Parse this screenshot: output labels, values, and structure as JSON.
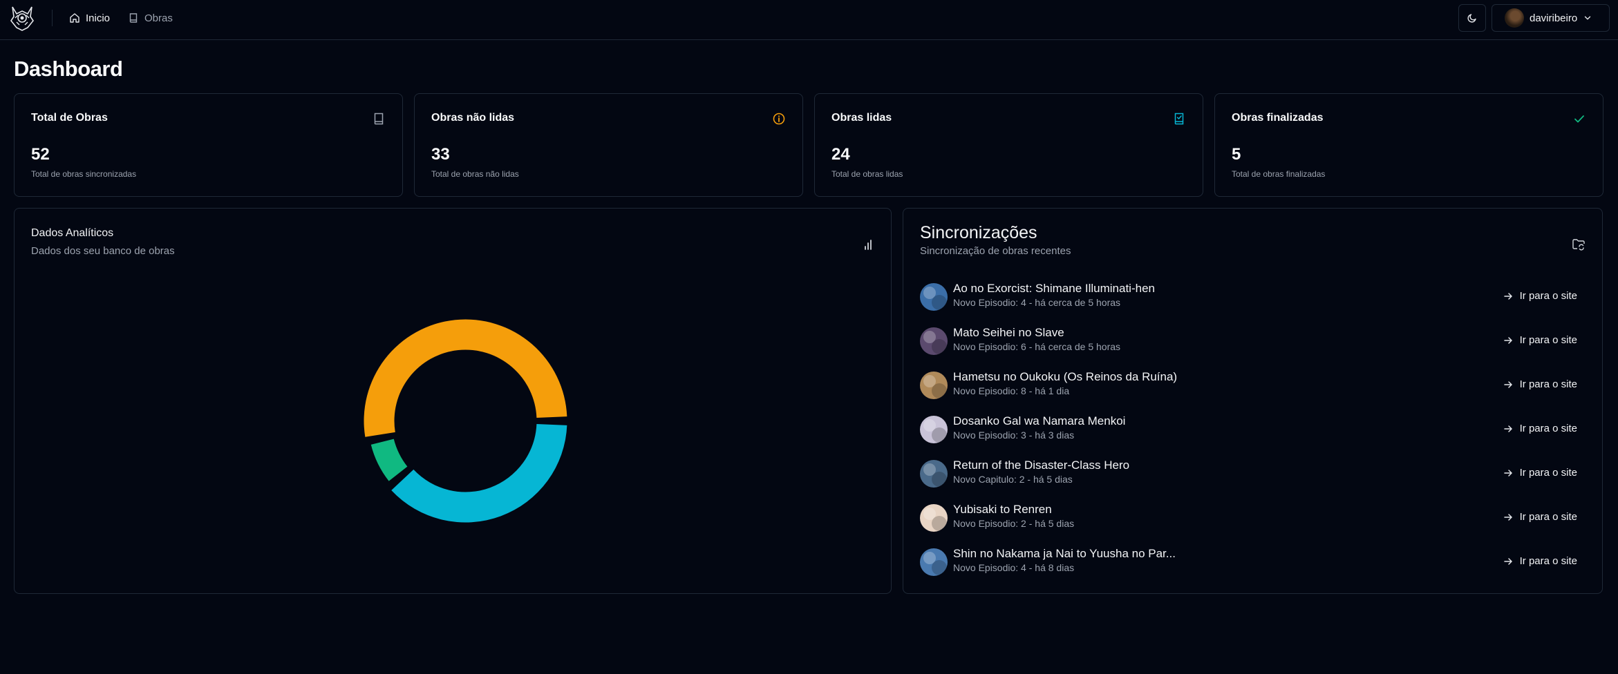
{
  "nav": {
    "items": [
      {
        "label": "Inicio",
        "icon": "home-icon"
      },
      {
        "label": "Obras",
        "icon": "book-icon"
      }
    ],
    "theme_toggle_icon": "moon-icon",
    "user": {
      "name": "daviribeiro",
      "icon": "chevron-down-icon"
    }
  },
  "page": {
    "title": "Dashboard"
  },
  "stats": [
    {
      "title": "Total de Obras",
      "value": "52",
      "subtitle": "Total de obras sincronizadas",
      "icon": "book-icon",
      "color": "#9ca3af"
    },
    {
      "title": "Obras não lidas",
      "value": "33",
      "subtitle": "Total de obras não lidas",
      "icon": "info-icon",
      "color": "#f59e0b"
    },
    {
      "title": "Obras lidas",
      "value": "24",
      "subtitle": "Total de obras lidas",
      "icon": "book-check-icon",
      "color": "#06b6d4"
    },
    {
      "title": "Obras finalizadas",
      "value": "5",
      "subtitle": "Total de obras finalizadas",
      "icon": "check-icon",
      "color": "#10b981"
    }
  ],
  "analytics": {
    "title": "Dados Analíticos",
    "subtitle": "Dados dos seu banco de obras",
    "icon": "bar-chart-icon"
  },
  "chart_data": {
    "type": "pie",
    "variant": "donut",
    "series": [
      {
        "values": [
          24,
          5,
          33
        ],
        "colors": [
          "#06b6d4",
          "#10b981",
          "#f59e0b"
        ]
      }
    ]
  },
  "sync": {
    "title": "Sincronizações",
    "subtitle": "Sincronização de obras recentes",
    "icon": "folder-sync-icon",
    "link_label": "Ir para o site",
    "items": [
      {
        "name": "Ao no Exorcist: Shimane Illuminati-hen",
        "detail": "Novo Episodio: 4 - há cerca de 5 horas",
        "thumb_color": "#3b6ea8"
      },
      {
        "name": "Mato Seihei no Slave",
        "detail": "Novo Episodio: 6 - há cerca de 5 horas",
        "thumb_color": "#5b4a6e"
      },
      {
        "name": "Hametsu no Oukoku (Os Reinos da Ruína)",
        "detail": "Novo Episodio: 8 - há 1 dia",
        "thumb_color": "#b08a5a"
      },
      {
        "name": "Dosanko Gal wa Namara Menkoi",
        "detail": "Novo Episodio: 3 - há 3 dias",
        "thumb_color": "#c9c3d8"
      },
      {
        "name": "Return of the Disaster-Class Hero",
        "detail": "Novo Capitulo: 2 - há 5 dias",
        "thumb_color": "#4a6a8a"
      },
      {
        "name": "Yubisaki to Renren",
        "detail": "Novo Episodio: 2 - há 5 dias",
        "thumb_color": "#e8d4c4"
      },
      {
        "name": "Shin no Nakama ja Nai to Yuusha no Par...",
        "detail": "Novo Episodio: 4 - há 8 dias",
        "thumb_color": "#4a7ab0"
      }
    ]
  }
}
